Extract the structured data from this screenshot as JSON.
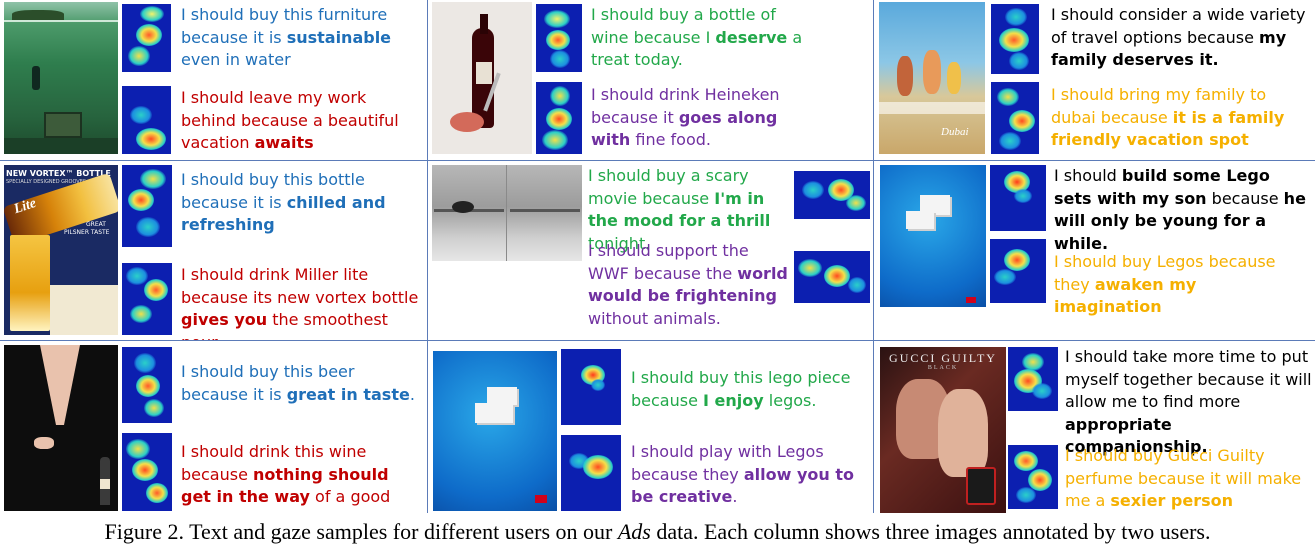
{
  "caption": {
    "label": "Figure 2.",
    "text_before": "Text and gaze samples for different users on our",
    "italic": "Ads",
    "text_after": "data. Each column shows three images annotated by two users."
  },
  "cells": [
    {
      "ad_name": "furniture-underwater-ad",
      "annotations": [
        {
          "color": "#1f6fb8",
          "pre": "I should buy this furniture because it is ",
          "bold": "sustainable",
          "post": " even in water"
        },
        {
          "color": "#c00000",
          "pre": "I should leave my work behind because a beautiful vacation ",
          "bold": "awaits",
          "post": ""
        }
      ]
    },
    {
      "ad_name": "wine-bottle-ad",
      "annotations": [
        {
          "color": "#22a84a",
          "pre": "I should buy a bottle of wine because I ",
          "bold": "deserve",
          "post": " a treat today."
        },
        {
          "color": "#7030a0",
          "pre": "I should drink Heineken because it ",
          "bold": "goes along with",
          "post": " fine food."
        }
      ]
    },
    {
      "ad_name": "dubai-beach-ad",
      "ad_text": "Dubai",
      "annotations": [
        {
          "color": "#000000",
          "pre": "I should consider a wide variety of travel options because ",
          "bold": "my family deserves it.",
          "post": ""
        },
        {
          "color": "#f5b000",
          "pre": "I should bring my family to dubai because ",
          "bold": "it is a family friendly vacation spot",
          "post": ""
        }
      ]
    },
    {
      "ad_name": "miller-lite-ad",
      "ad_text": {
        "headline": "NEW VORTEX™ BOTTLE",
        "sub": "SPECIALLY DESIGNED GROOVES",
        "brand": "Lite",
        "tag1": "GREAT",
        "tag2": "PILSNER TASTE"
      },
      "annotations": [
        {
          "color": "#1f6fb8",
          "pre": "I should buy this bottle because it is ",
          "bold": "chilled and refreshing",
          "post": ""
        },
        {
          "color": "#c00000",
          "pre": "I should drink Miller lite because its new vortex bottle ",
          "bold": "gives you",
          "post": " the smoothest pour."
        }
      ]
    },
    {
      "ad_name": "wwf-ad",
      "annotations": [
        {
          "color": "#22a84a",
          "pre": "I should buy a scary movie because ",
          "bold": "I'm in the mood for a thrill",
          "post": " tonight."
        },
        {
          "color": "#7030a0",
          "pre": "I should support the WWF because the ",
          "bold": "world would be frightening",
          "post": " without animals."
        }
      ]
    },
    {
      "ad_name": "lego-ad-1",
      "annotations": [
        {
          "color": "#000000",
          "pre": "I should ",
          "bold": "build some Lego sets with my son",
          "post": " because ",
          "bold2": "he will only be young for a while."
        },
        {
          "color": "#f5b000",
          "pre": "I should buy Legos because they ",
          "bold": "awaken my imagination",
          "post": ""
        }
      ]
    },
    {
      "ad_name": "beer-woman-ad",
      "annotations": [
        {
          "color": "#1f6fb8",
          "pre": "I should buy this beer because it is ",
          "bold": "great in taste",
          "post": "."
        },
        {
          "color": "#c00000",
          "pre": "I should drink this wine because ",
          "bold": "nothing should get in the way",
          "post": " of a good time"
        }
      ]
    },
    {
      "ad_name": "lego-ad-2",
      "annotations": [
        {
          "color": "#22a84a",
          "pre": "I should buy this lego piece because ",
          "bold": "I enjoy",
          "post": " legos."
        },
        {
          "color": "#7030a0",
          "pre": "I should play with Legos because they ",
          "bold": "allow you to be creative",
          "post": "."
        }
      ]
    },
    {
      "ad_name": "gucci-guilty-ad",
      "ad_text": {
        "brand": "GUCCI GUILTY",
        "sub": "BLACK"
      },
      "annotations": [
        {
          "color": "#000000",
          "pre": "I should take more time to put myself together because it will allow me to find more ",
          "bold": "appropriate companionship.",
          "post": ""
        },
        {
          "color": "#f5b000",
          "pre": "I should buy Gucci Guilty perfume because it will make me a ",
          "bold": "sexier person",
          "post": ""
        }
      ]
    }
  ]
}
